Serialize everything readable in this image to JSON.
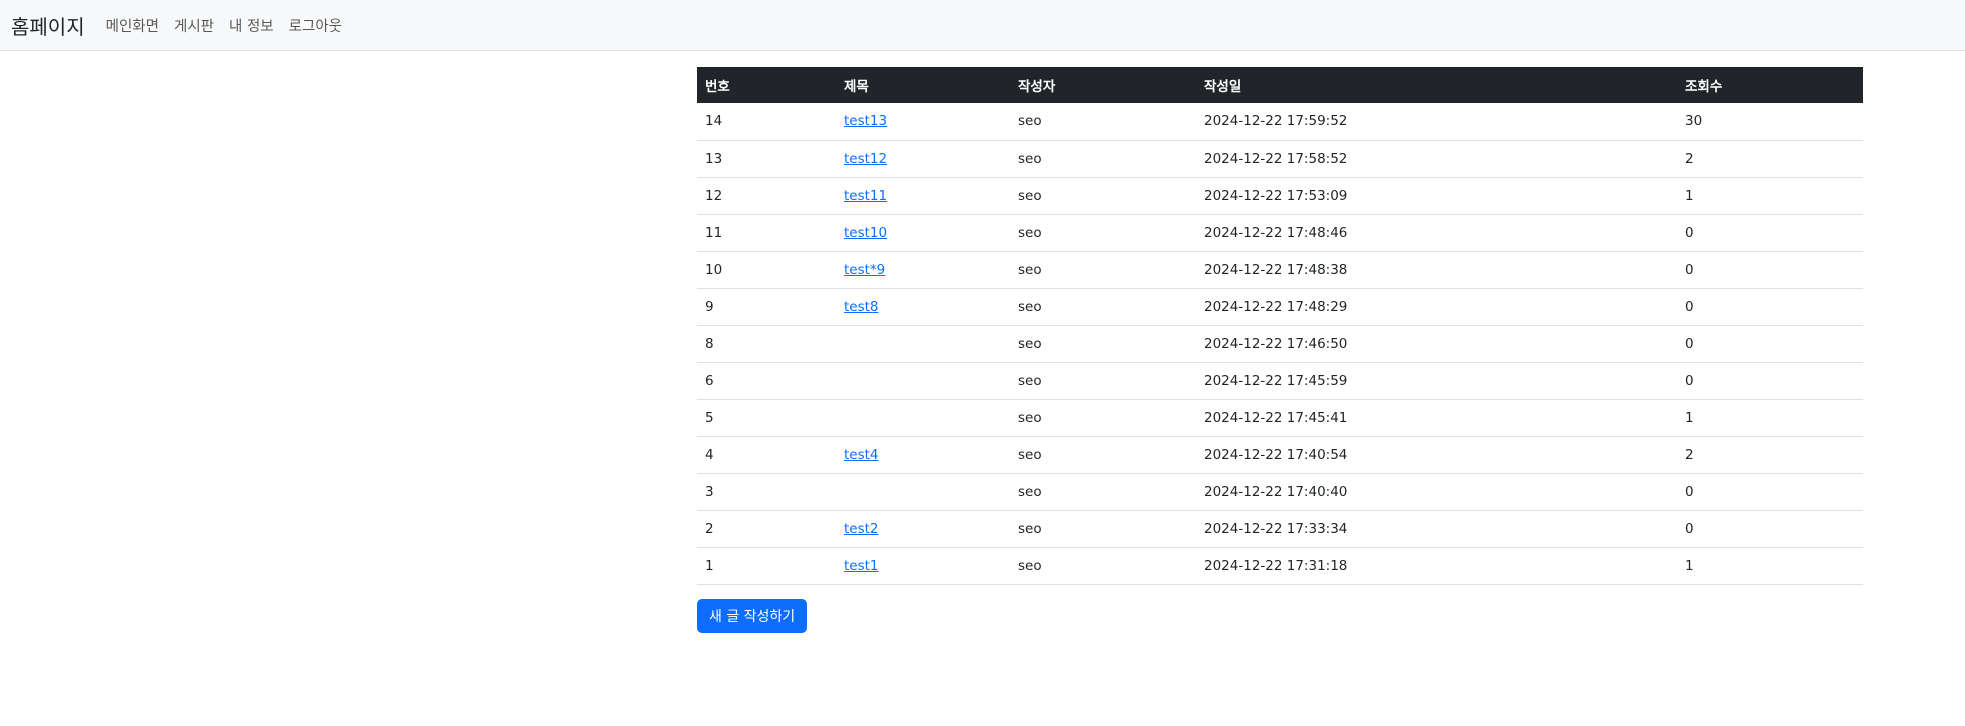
{
  "navbar": {
    "brand": "홈페이지",
    "links": [
      "메인화면",
      "게시판",
      "내 정보",
      "로그아웃"
    ]
  },
  "board": {
    "headers": [
      "번호",
      "제목",
      "작성자",
      "작성일",
      "조회수"
    ],
    "rows": [
      {
        "no": "14",
        "title": "test13",
        "author": "seo",
        "date": "2024-12-22 17:59:52",
        "views": "30"
      },
      {
        "no": "13",
        "title": "test12",
        "author": "seo",
        "date": "2024-12-22 17:58:52",
        "views": "2"
      },
      {
        "no": "12",
        "title": "test11",
        "author": "seo",
        "date": "2024-12-22 17:53:09",
        "views": "1"
      },
      {
        "no": "11",
        "title": "test10",
        "author": "seo",
        "date": "2024-12-22 17:48:46",
        "views": "0"
      },
      {
        "no": "10",
        "title": "test*9",
        "author": "seo",
        "date": "2024-12-22 17:48:38",
        "views": "0"
      },
      {
        "no": "9",
        "title": "test8",
        "author": "seo",
        "date": "2024-12-22 17:48:29",
        "views": "0"
      },
      {
        "no": "8",
        "title": "",
        "author": "seo",
        "date": "2024-12-22 17:46:50",
        "views": "0"
      },
      {
        "no": "6",
        "title": "",
        "author": "seo",
        "date": "2024-12-22 17:45:59",
        "views": "0"
      },
      {
        "no": "5",
        "title": "",
        "author": "seo",
        "date": "2024-12-22 17:45:41",
        "views": "1"
      },
      {
        "no": "4",
        "title": "test4",
        "author": "seo",
        "date": "2024-12-22 17:40:54",
        "views": "2"
      },
      {
        "no": "3",
        "title": "",
        "author": "seo",
        "date": "2024-12-22 17:40:40",
        "views": "0"
      },
      {
        "no": "2",
        "title": "test2",
        "author": "seo",
        "date": "2024-12-22 17:33:34",
        "views": "0"
      },
      {
        "no": "1",
        "title": "test1",
        "author": "seo",
        "date": "2024-12-22 17:31:18",
        "views": "1"
      }
    ],
    "new_post_label": "새 글 작성하기"
  },
  "colors": {
    "navbar_bg": "#f8f9fa",
    "header_bg": "#212529",
    "link": "#0d6efd",
    "button_bg": "#0d6efd"
  }
}
